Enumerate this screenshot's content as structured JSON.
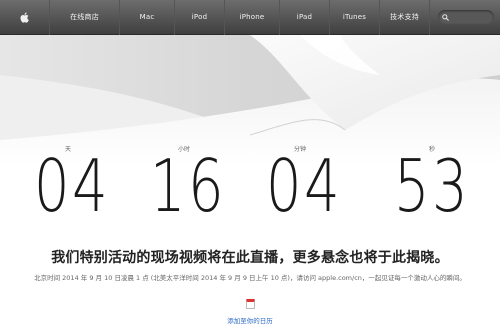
{
  "nav": {
    "items": [
      {
        "label": "在线商店"
      },
      {
        "label": "Mac"
      },
      {
        "label": "iPod"
      },
      {
        "label": "iPhone"
      },
      {
        "label": "iPad"
      },
      {
        "label": "iTunes"
      },
      {
        "label": "技术支持"
      }
    ]
  },
  "countdown": {
    "days": {
      "label": "天",
      "value": "04"
    },
    "hours": {
      "label": "小时",
      "value": "16"
    },
    "minutes": {
      "label": "分钟",
      "value": "04"
    },
    "seconds": {
      "label": "秒",
      "value": "53"
    }
  },
  "headline": "我们特别活动的现场视频将在此直播，更多悬念也将于此揭晓。",
  "subline": "北京时间 2014 年 9 月 10 日凌晨 1 点 (北美太平洋时间 2014 年 9 月 9 日上午 10 点)，请访问 apple.com/cn，一起见证每一个激动人心的瞬间。",
  "calendar": {
    "link_label": "添加至你的日历"
  },
  "colors": {
    "nav_bg": "#4f4f4f",
    "link": "#2a6ac8",
    "calendar_accent": "#d33333"
  }
}
